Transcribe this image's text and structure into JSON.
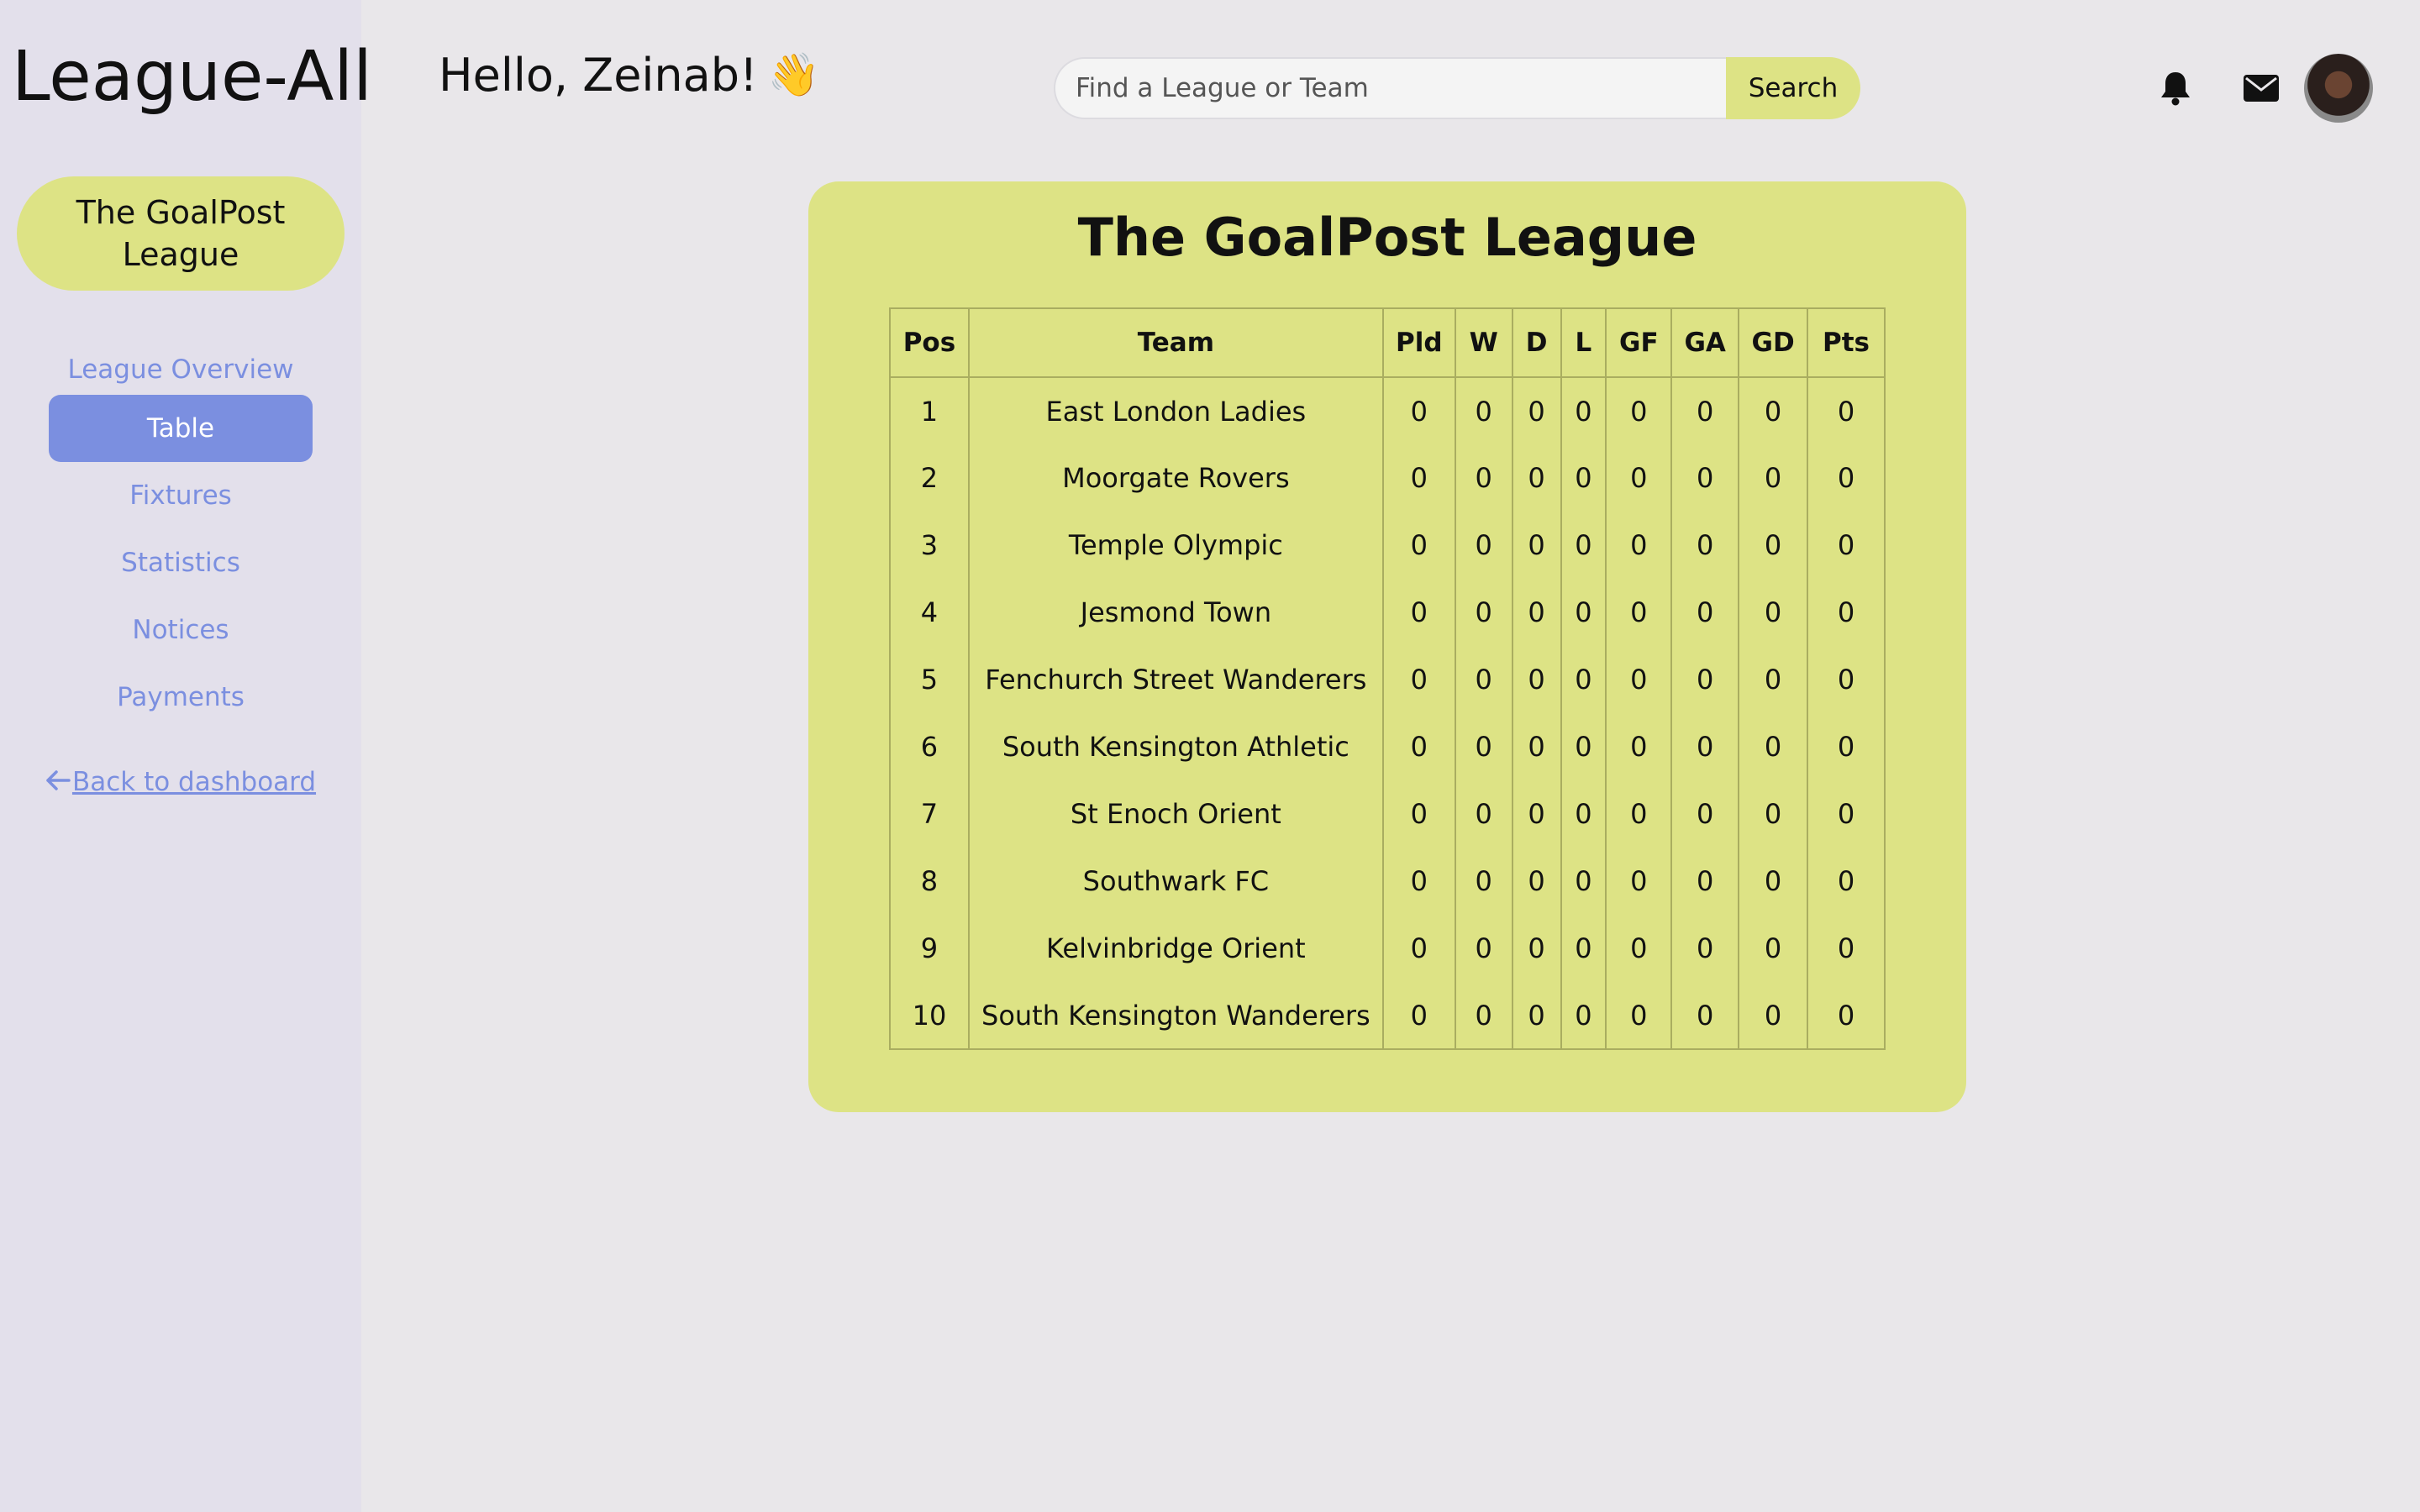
{
  "app": {
    "name": "League-All"
  },
  "sidebar": {
    "league_name": "The GoalPost League",
    "nav_items": [
      {
        "label": "League Overview",
        "active": false
      },
      {
        "label": "Table",
        "active": true
      },
      {
        "label": "Fixtures",
        "active": false
      },
      {
        "label": "Statistics",
        "active": false
      },
      {
        "label": "Notices",
        "active": false
      },
      {
        "label": "Payments",
        "active": false
      }
    ],
    "back_link": "Back to dashboard"
  },
  "header": {
    "greeting": "Hello, Zeinab!",
    "greeting_emoji": "👋",
    "search": {
      "placeholder": "Find a League or Team",
      "value": "",
      "button_label": "Search"
    },
    "icons": [
      "bell-icon",
      "envelope-icon"
    ]
  },
  "main": {
    "title": "The GoalPost League",
    "table": {
      "columns": [
        "Pos",
        "Team",
        "Pld",
        "W",
        "D",
        "L",
        "GF",
        "GA",
        "GD",
        "Pts"
      ],
      "rows": [
        [
          "1",
          "East London Ladies",
          "0",
          "0",
          "0",
          "0",
          "0",
          "0",
          "0",
          "0"
        ],
        [
          "2",
          "Moorgate Rovers",
          "0",
          "0",
          "0",
          "0",
          "0",
          "0",
          "0",
          "0"
        ],
        [
          "3",
          "Temple Olympic",
          "0",
          "0",
          "0",
          "0",
          "0",
          "0",
          "0",
          "0"
        ],
        [
          "4",
          "Jesmond Town",
          "0",
          "0",
          "0",
          "0",
          "0",
          "0",
          "0",
          "0"
        ],
        [
          "5",
          "Fenchurch Street Wanderers",
          "0",
          "0",
          "0",
          "0",
          "0",
          "0",
          "0",
          "0"
        ],
        [
          "6",
          "South Kensington Athletic",
          "0",
          "0",
          "0",
          "0",
          "0",
          "0",
          "0",
          "0"
        ],
        [
          "7",
          "St Enoch Orient",
          "0",
          "0",
          "0",
          "0",
          "0",
          "0",
          "0",
          "0"
        ],
        [
          "8",
          "Southwark FC",
          "0",
          "0",
          "0",
          "0",
          "0",
          "0",
          "0",
          "0"
        ],
        [
          "9",
          "Kelvinbridge Orient",
          "0",
          "0",
          "0",
          "0",
          "0",
          "0",
          "0",
          "0"
        ],
        [
          "10",
          "South Kensington Wanderers",
          "0",
          "0",
          "0",
          "0",
          "0",
          "0",
          "0",
          "0"
        ]
      ]
    }
  },
  "colors": {
    "accent_green": "#dde385",
    "accent_blue": "#7b8fe0",
    "sidebar_bg": "#e3e0eb",
    "page_bg": "#e9e7ea"
  }
}
